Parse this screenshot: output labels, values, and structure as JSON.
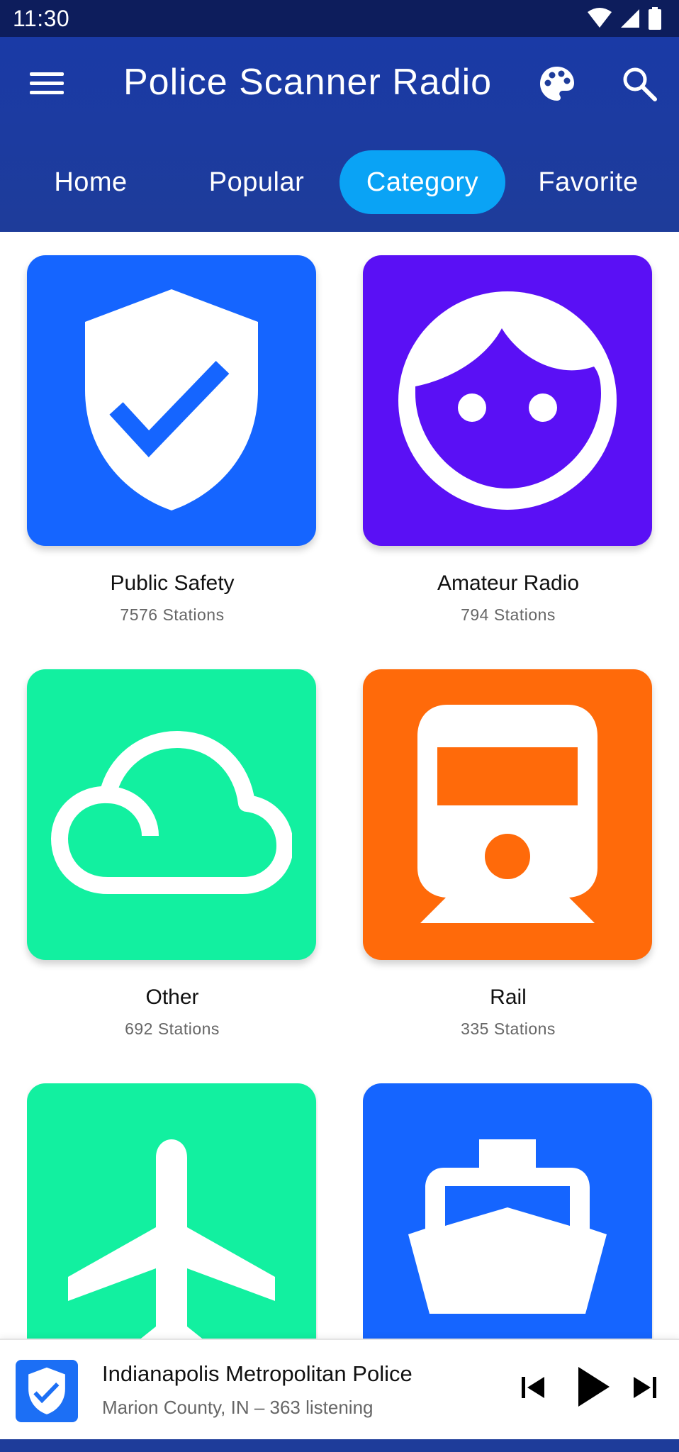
{
  "status_bar": {
    "time": "11:30"
  },
  "app_bar": {
    "title": "Police Scanner Radio",
    "tabs": [
      {
        "label": "Home",
        "active": false
      },
      {
        "label": "Popular",
        "active": false
      },
      {
        "label": "Category",
        "active": true
      },
      {
        "label": "Favorite",
        "active": false
      }
    ]
  },
  "categories": [
    {
      "name": "Public Safety",
      "count": "7576 Stations",
      "icon": "shield-check-icon",
      "color": "#1565ff"
    },
    {
      "name": "Amateur Radio",
      "count": "794 Stations",
      "icon": "face-icon",
      "color": "#5a10f5"
    },
    {
      "name": "Other",
      "count": "692 Stations",
      "icon": "cloud-icon",
      "color": "#12f0a0"
    },
    {
      "name": "Rail",
      "count": "335 Stations",
      "icon": "train-icon",
      "color": "#ff6a0a"
    },
    {
      "name": "",
      "count": "",
      "icon": "airplane-icon",
      "color": "#12f0a0"
    },
    {
      "name": "",
      "count": "",
      "icon": "ship-icon",
      "color": "#1565ff"
    }
  ],
  "player": {
    "title": "Indianapolis Metropolitan Police",
    "subtitle": "Marion County, IN – 363 listening",
    "art_icon": "shield-check-icon"
  },
  "colors": {
    "app_bar": "#1e3c9a",
    "status_bar": "#0d1d5c",
    "active_tab": "#0aa3f5"
  }
}
